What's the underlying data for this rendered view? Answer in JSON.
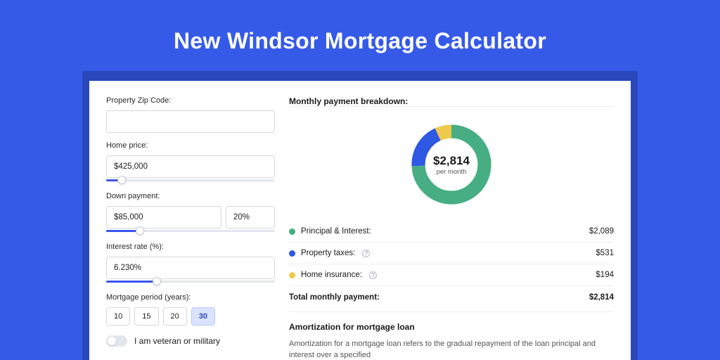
{
  "title": "New Windsor Mortgage Calculator",
  "left": {
    "zip_label": "Property Zip Code:",
    "zip_value": "",
    "home_price_label": "Home price:",
    "home_price_value": "$425,000",
    "home_price_pct": 9,
    "down_payment_label": "Down payment:",
    "down_payment_value": "$85,000",
    "down_payment_pct_value": "20%",
    "down_payment_slider_pct": 20,
    "interest_label": "Interest rate (%):",
    "interest_value": "6.230%",
    "interest_slider_pct": 30,
    "period_label": "Mortgage period (years):",
    "periods": [
      "10",
      "15",
      "20",
      "30"
    ],
    "active_period": "30",
    "veteran_label": "I am veteran or military"
  },
  "right": {
    "heading": "Monthly payment breakdown:",
    "center_amount": "$2,814",
    "center_sub": "per month",
    "legend": {
      "pi_label": "Principal & Interest:",
      "pi_value": "$2,089",
      "tax_label": "Property taxes:",
      "tax_value": "$531",
      "ins_label": "Home insurance:",
      "ins_value": "$194"
    },
    "total_label": "Total monthly payment:",
    "total_value": "$2,814",
    "amort_heading": "Amortization for mortgage loan",
    "amort_text": "Amortization for a mortgage loan refers to the gradual repayment of the loan principal and interest over a specified"
  },
  "chart_data": {
    "type": "pie",
    "title": "Monthly payment breakdown",
    "series": [
      {
        "name": "Principal & Interest",
        "value": 2089,
        "color": "#46ae82"
      },
      {
        "name": "Property taxes",
        "value": 531,
        "color": "#2f58e3"
      },
      {
        "name": "Home insurance",
        "value": 194,
        "color": "#efc94c"
      }
    ],
    "total": 2814,
    "center_label": "$2,814 per month"
  }
}
